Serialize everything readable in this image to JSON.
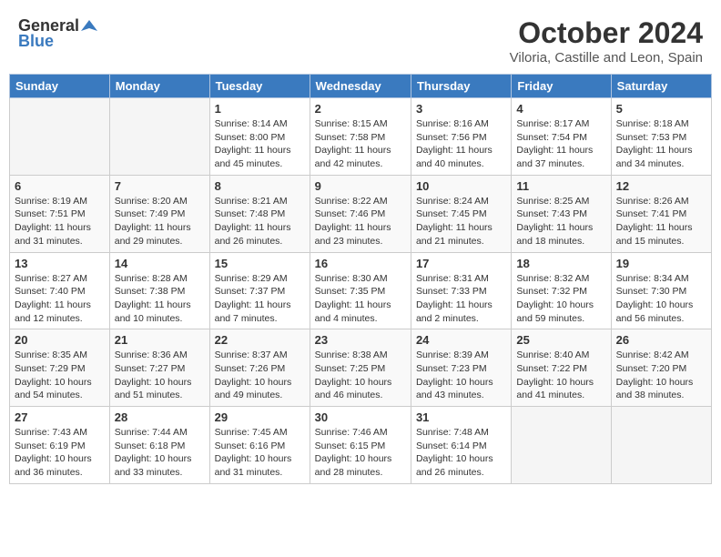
{
  "header": {
    "logo_general": "General",
    "logo_blue": "Blue",
    "month": "October 2024",
    "location": "Viloria, Castille and Leon, Spain"
  },
  "days_of_week": [
    "Sunday",
    "Monday",
    "Tuesday",
    "Wednesday",
    "Thursday",
    "Friday",
    "Saturday"
  ],
  "weeks": [
    [
      {
        "day": "",
        "info": ""
      },
      {
        "day": "",
        "info": ""
      },
      {
        "day": "1",
        "info": "Sunrise: 8:14 AM\nSunset: 8:00 PM\nDaylight: 11 hours and 45 minutes."
      },
      {
        "day": "2",
        "info": "Sunrise: 8:15 AM\nSunset: 7:58 PM\nDaylight: 11 hours and 42 minutes."
      },
      {
        "day": "3",
        "info": "Sunrise: 8:16 AM\nSunset: 7:56 PM\nDaylight: 11 hours and 40 minutes."
      },
      {
        "day": "4",
        "info": "Sunrise: 8:17 AM\nSunset: 7:54 PM\nDaylight: 11 hours and 37 minutes."
      },
      {
        "day": "5",
        "info": "Sunrise: 8:18 AM\nSunset: 7:53 PM\nDaylight: 11 hours and 34 minutes."
      }
    ],
    [
      {
        "day": "6",
        "info": "Sunrise: 8:19 AM\nSunset: 7:51 PM\nDaylight: 11 hours and 31 minutes."
      },
      {
        "day": "7",
        "info": "Sunrise: 8:20 AM\nSunset: 7:49 PM\nDaylight: 11 hours and 29 minutes."
      },
      {
        "day": "8",
        "info": "Sunrise: 8:21 AM\nSunset: 7:48 PM\nDaylight: 11 hours and 26 minutes."
      },
      {
        "day": "9",
        "info": "Sunrise: 8:22 AM\nSunset: 7:46 PM\nDaylight: 11 hours and 23 minutes."
      },
      {
        "day": "10",
        "info": "Sunrise: 8:24 AM\nSunset: 7:45 PM\nDaylight: 11 hours and 21 minutes."
      },
      {
        "day": "11",
        "info": "Sunrise: 8:25 AM\nSunset: 7:43 PM\nDaylight: 11 hours and 18 minutes."
      },
      {
        "day": "12",
        "info": "Sunrise: 8:26 AM\nSunset: 7:41 PM\nDaylight: 11 hours and 15 minutes."
      }
    ],
    [
      {
        "day": "13",
        "info": "Sunrise: 8:27 AM\nSunset: 7:40 PM\nDaylight: 11 hours and 12 minutes."
      },
      {
        "day": "14",
        "info": "Sunrise: 8:28 AM\nSunset: 7:38 PM\nDaylight: 11 hours and 10 minutes."
      },
      {
        "day": "15",
        "info": "Sunrise: 8:29 AM\nSunset: 7:37 PM\nDaylight: 11 hours and 7 minutes."
      },
      {
        "day": "16",
        "info": "Sunrise: 8:30 AM\nSunset: 7:35 PM\nDaylight: 11 hours and 4 minutes."
      },
      {
        "day": "17",
        "info": "Sunrise: 8:31 AM\nSunset: 7:33 PM\nDaylight: 11 hours and 2 minutes."
      },
      {
        "day": "18",
        "info": "Sunrise: 8:32 AM\nSunset: 7:32 PM\nDaylight: 10 hours and 59 minutes."
      },
      {
        "day": "19",
        "info": "Sunrise: 8:34 AM\nSunset: 7:30 PM\nDaylight: 10 hours and 56 minutes."
      }
    ],
    [
      {
        "day": "20",
        "info": "Sunrise: 8:35 AM\nSunset: 7:29 PM\nDaylight: 10 hours and 54 minutes."
      },
      {
        "day": "21",
        "info": "Sunrise: 8:36 AM\nSunset: 7:27 PM\nDaylight: 10 hours and 51 minutes."
      },
      {
        "day": "22",
        "info": "Sunrise: 8:37 AM\nSunset: 7:26 PM\nDaylight: 10 hours and 49 minutes."
      },
      {
        "day": "23",
        "info": "Sunrise: 8:38 AM\nSunset: 7:25 PM\nDaylight: 10 hours and 46 minutes."
      },
      {
        "day": "24",
        "info": "Sunrise: 8:39 AM\nSunset: 7:23 PM\nDaylight: 10 hours and 43 minutes."
      },
      {
        "day": "25",
        "info": "Sunrise: 8:40 AM\nSunset: 7:22 PM\nDaylight: 10 hours and 41 minutes."
      },
      {
        "day": "26",
        "info": "Sunrise: 8:42 AM\nSunset: 7:20 PM\nDaylight: 10 hours and 38 minutes."
      }
    ],
    [
      {
        "day": "27",
        "info": "Sunrise: 7:43 AM\nSunset: 6:19 PM\nDaylight: 10 hours and 36 minutes."
      },
      {
        "day": "28",
        "info": "Sunrise: 7:44 AM\nSunset: 6:18 PM\nDaylight: 10 hours and 33 minutes."
      },
      {
        "day": "29",
        "info": "Sunrise: 7:45 AM\nSunset: 6:16 PM\nDaylight: 10 hours and 31 minutes."
      },
      {
        "day": "30",
        "info": "Sunrise: 7:46 AM\nSunset: 6:15 PM\nDaylight: 10 hours and 28 minutes."
      },
      {
        "day": "31",
        "info": "Sunrise: 7:48 AM\nSunset: 6:14 PM\nDaylight: 10 hours and 26 minutes."
      },
      {
        "day": "",
        "info": ""
      },
      {
        "day": "",
        "info": ""
      }
    ]
  ]
}
